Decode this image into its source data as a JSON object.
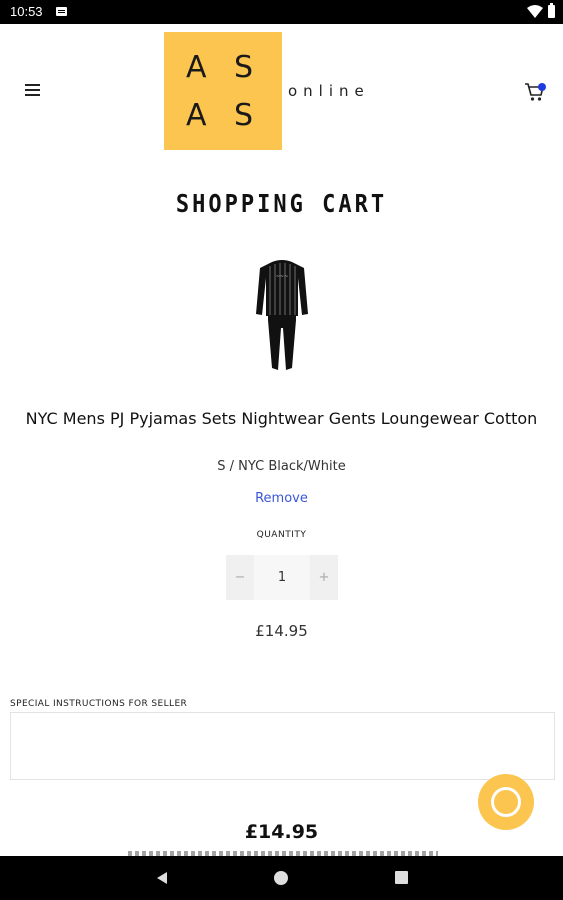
{
  "status_bar": {
    "time": "10:53"
  },
  "header": {
    "logo_letters": [
      "A",
      "S",
      "A",
      "S"
    ],
    "logo_word": "online",
    "logo_color": "#fcc54f",
    "cart_badge_color": "#1f3be0"
  },
  "page": {
    "title": "SHOPPING CART"
  },
  "cart_item": {
    "title": "NYC Mens PJ Pyjamas Sets Nightwear Gents Loungewear Cotton",
    "variant": "S / NYC Black/White",
    "remove_label": "Remove",
    "quantity_label": "QUANTITY",
    "quantity_value": "1",
    "decrement_label": "−",
    "increment_label": "+",
    "price": "£14.95"
  },
  "notes": {
    "label": "SPECIAL INSTRUCTIONS FOR SELLER",
    "value": ""
  },
  "summary": {
    "subtotal": "£14.95"
  },
  "icons": {
    "menu": "hamburger-menu-icon",
    "cart": "shopping-cart-icon",
    "chat": "chat-bubble-icon",
    "back": "back-triangle-icon",
    "home": "home-circle-icon",
    "recents": "recents-square-icon"
  }
}
